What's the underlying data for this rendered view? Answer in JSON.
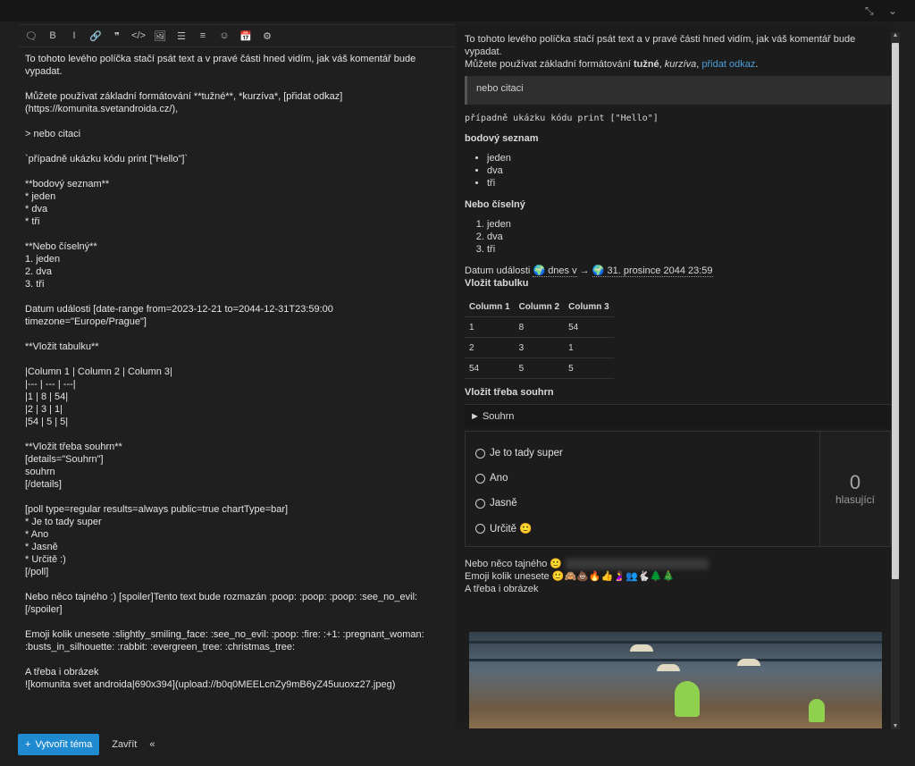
{
  "window": {
    "minimize_icon": "collapse-icon",
    "chevron_icon": "chevron-down-icon"
  },
  "toolbar": {
    "items": [
      "speech-bubble-icon",
      "bold-icon",
      "italic-icon",
      "link-icon",
      "quote-icon",
      "code-icon",
      "image-icon",
      "bullet-list-icon",
      "numbered-list-icon",
      "emoji-icon",
      "calendar-icon",
      "gear-icon"
    ],
    "labels": [
      "🗨",
      "B",
      "I",
      "🔗",
      "❞",
      "</>",
      "🖼",
      "☰",
      "≡",
      "☺",
      "📅",
      "⚙"
    ]
  },
  "editor": {
    "lines": [
      "To tohoto levého políčka stačí psát text a v pravé části hned vidím, jak váš komentář bude vypadat.",
      "",
      "Můžete používat základní formátování **tužné**, *kurzíva*, [přidat odkaz]",
      "(https://komunita.svetandroida.cz/),",
      "",
      "> nebo citaci",
      "",
      "`případně ukázku kódu print [\"Hello\"]`",
      "",
      "**bodový seznam**",
      "* jeden",
      "* dva",
      "* tři",
      "",
      "**Nebo číselný**",
      "1. jeden",
      "2. dva",
      "3. tři",
      "",
      "Datum události [date-range from=2023-12-21 to=2044-12-31T23:59:00 timezone=\"Europe/Prague\"]",
      "",
      "**Vložit tabulku**",
      "",
      "|Column 1 | Column 2 | Column 3|",
      "|--- | --- | ---|",
      "|1 | 8 | 54|",
      "|2 | 3 | 1|",
      "|54 | 5 | 5|",
      "",
      "**Vložit třeba souhrn**",
      "[details=\"Souhrn\"]",
      "souhrn",
      "[/details]",
      "",
      "[poll type=regular results=always public=true chartType=bar]",
      "* Je to tady super",
      "* Ano",
      "* Jasně",
      "* Určitě :)",
      "[/poll]",
      "",
      "Nebo něco tajného :) [spoiler]Tento text bude rozmazán :poop: :poop: :poop: :see_no_evil:[/spoiler]",
      "",
      "Emoji kolik unesete :slightly_smiling_face: :see_no_evil: :poop: :fire: :+1: :pregnant_woman:",
      ":busts_in_silhouette: :rabbit: :evergreen_tree: :christmas_tree:",
      "",
      "A třeba i obrázek",
      "![komunita svet androida|690x394](upload://b0q0MEELcnZy9mB6yZ45uuoxz27.jpeg)"
    ]
  },
  "preview": {
    "intro": "To tohoto levého políčka stačí psát text a v pravé části hned vidím, jak váš komentář bude vypadat.",
    "format_prefix": "Můžete používat základní formátování ",
    "format_bold": "tužné",
    "format_sep1": ", ",
    "format_italic": "kurzíva",
    "format_sep2": ", ",
    "format_link": "přidat odkaz",
    "format_end": ".",
    "quote": "nebo citaci",
    "code": "případně ukázku kódu print [\"Hello\"]",
    "bullet_heading": "bodový seznam",
    "bullets": [
      "jeden",
      "dva",
      "tři"
    ],
    "numbered_heading": "Nebo číselný",
    "numbered": [
      "jeden",
      "dva",
      "tři"
    ],
    "date_prefix": "Datum události ",
    "date_from": "🌍 dnes v",
    "date_arrow": " → ",
    "date_to": "🌍 31. prosince 2044 23:59",
    "table_heading": "Vložit tabulku",
    "table": {
      "headers": [
        "Column 1",
        "Column 2",
        "Column 3"
      ],
      "rows": [
        [
          "1",
          "8",
          "54"
        ],
        [
          "2",
          "3",
          "1"
        ],
        [
          "54",
          "5",
          "5"
        ]
      ]
    },
    "details_heading": "Vložit třeba souhrn",
    "details_summary": "► Souhrn",
    "poll": {
      "options": [
        "Je to tady super",
        "Ano",
        "Jasně",
        "Určitě 🙂"
      ],
      "count": "0",
      "count_label": "hlasující"
    },
    "secret_prefix": "Nebo něco tajného 🙂",
    "emoji_prefix": "Emoji kolik unesete ",
    "emojis": "🙂🙈💩🔥👍🤰👥🐇🌲🎄",
    "image_caption": "A třeba i obrázek"
  },
  "footer": {
    "create_label": "Vytvořit téma",
    "create_icon": "+",
    "close_label": "Zavřít",
    "collapse_label": "«"
  }
}
